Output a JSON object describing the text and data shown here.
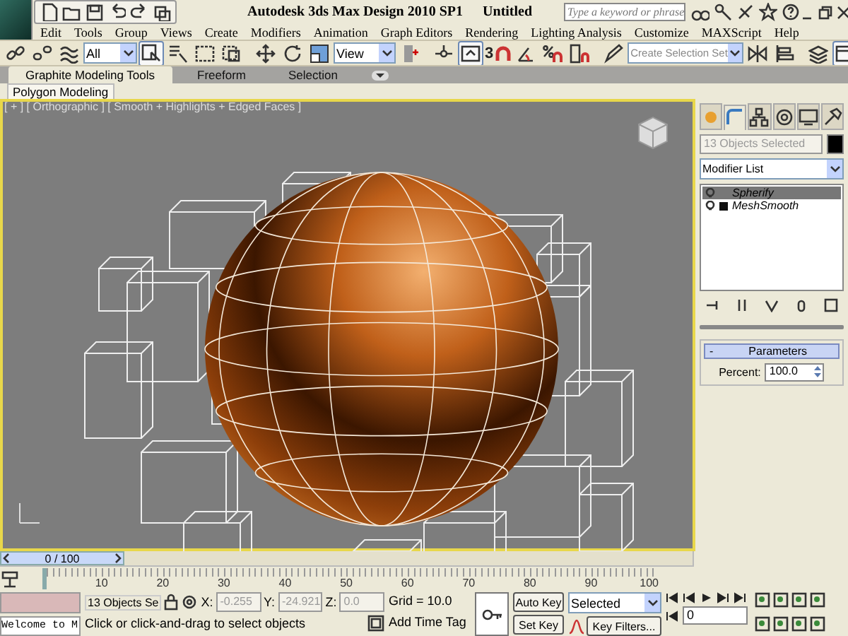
{
  "window": {
    "title": "Autodesk 3ds Max Design 2010 SP1",
    "document": "Untitled"
  },
  "search": {
    "placeholder": "Type a keyword or phrase"
  },
  "menu": [
    "Edit",
    "Tools",
    "Group",
    "Views",
    "Create",
    "Modifiers",
    "Animation",
    "Graph Editors",
    "Rendering",
    "Lighting Analysis",
    "Customize",
    "MAXScript",
    "Help"
  ],
  "toolbar": {
    "selection_filter": "All",
    "reference_coordinate": "View",
    "snap_toggle": "3",
    "selection_set": {
      "placeholder": "Create Selection Set"
    }
  },
  "ribbon": {
    "tabs": [
      {
        "label": "Graphite Modeling Tools",
        "selected": true
      },
      {
        "label": "Freeform",
        "selected": false
      },
      {
        "label": "Selection",
        "selected": false
      }
    ],
    "panel_tabs": [
      {
        "label": "Polygon Modeling",
        "selected": true
      }
    ]
  },
  "viewport": {
    "label": "[ + ] [ Orthographic ] [ Smooth + Highlights + Edged Faces ]",
    "active": true
  },
  "command_panel": {
    "tabs": [
      {
        "kind": "create",
        "selected": false
      },
      {
        "kind": "modify",
        "selected": true
      },
      {
        "kind": "hierarchy",
        "selected": false
      },
      {
        "kind": "motion",
        "selected": false
      },
      {
        "kind": "display",
        "selected": false
      },
      {
        "kind": "utilities",
        "selected": false
      }
    ],
    "selection_name": {
      "placeholder": "13 Objects Selected"
    },
    "modifier_list": "Modifier List",
    "stack": [
      {
        "label": "Spherify",
        "selected": true,
        "expandable": false
      },
      {
        "label": "MeshSmooth",
        "selected": false,
        "expandable": true
      }
    ],
    "rollout": {
      "toggle": "-",
      "title": "Parameters",
      "params": [
        {
          "label": "Percent:",
          "value": "100.0"
        }
      ]
    }
  },
  "time_slider": {
    "label": "0 / 100",
    "level": 0
  },
  "track_bar": {
    "labels": [
      "10",
      "20",
      "30",
      "40",
      "50",
      "60",
      "70",
      "80",
      "90",
      "100"
    ]
  },
  "status": {
    "listener": "Welcome to M",
    "selection": "13 Objects Se",
    "coords": [
      {
        "label": "X:",
        "value": "-0.255",
        "disabled": true
      },
      {
        "label": "Y:",
        "value": "-24.921",
        "disabled": true
      },
      {
        "label": "Z:",
        "value": "0.0",
        "disabled": true
      }
    ],
    "grid": "Grid = 10.0",
    "prompt": "Click or click-and-drag to select objects",
    "time_tag": "Add Time Tag",
    "auto_key": "Auto Key",
    "set_key": "Set Key",
    "key_mode": "Selected",
    "key_filters": "Key Filters...",
    "frame": "0"
  }
}
